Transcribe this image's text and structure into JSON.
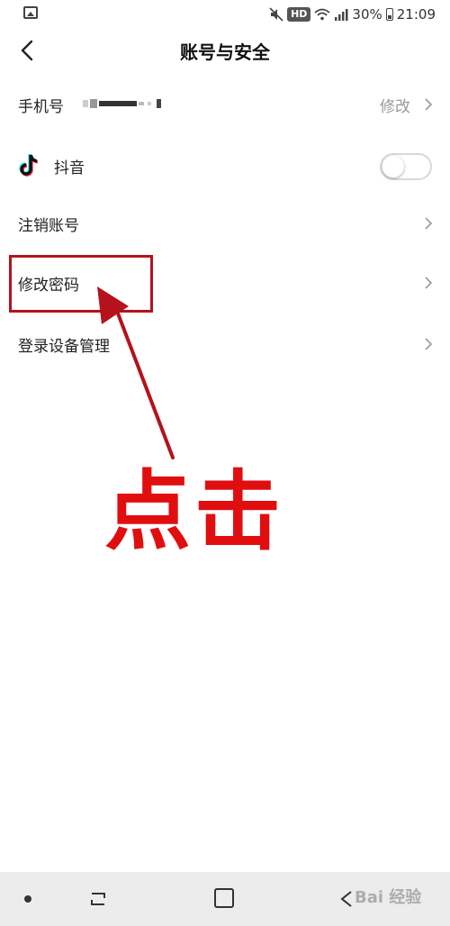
{
  "status_bar": {
    "hd": "HD",
    "battery": "30%",
    "time": "21:09"
  },
  "header": {
    "title": "账号与安全"
  },
  "rows": [
    {
      "label": "手机号",
      "action": "修改"
    },
    {
      "label": "抖音"
    },
    {
      "label": "注销账号"
    },
    {
      "label": "修改密码"
    },
    {
      "label": "登录设备管理"
    }
  ],
  "annotation": {
    "text": "点击",
    "color": "#e10e10"
  },
  "nav": {
    "watermark": "Bai 经验"
  },
  "colors": {
    "accent_red": "#b5121b",
    "secondary_text": "#999999",
    "nav_bg": "#ececec"
  }
}
